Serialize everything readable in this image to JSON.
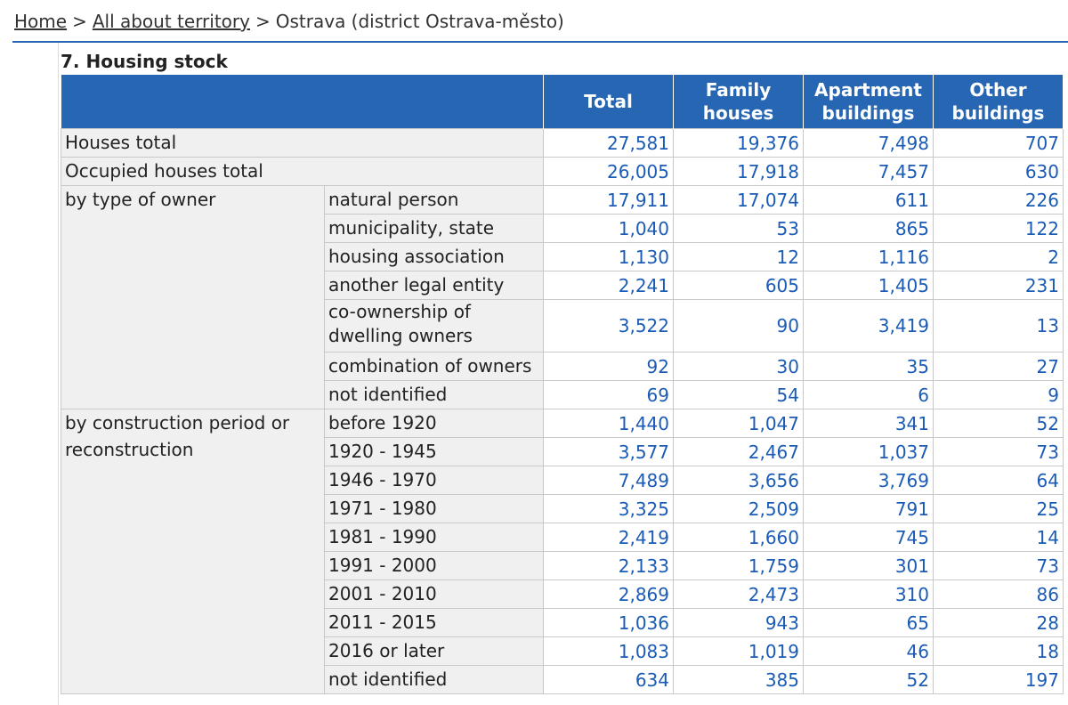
{
  "breadcrumb": {
    "home": "Home",
    "sep1": ">",
    "territory": "All about territory",
    "sep2": ">",
    "current": "Ostrava (district Ostrava-město)"
  },
  "section": {
    "title": "7. Housing stock"
  },
  "table": {
    "headers": [
      "Total",
      "Family houses",
      "Apartment buildings",
      "Other buildings"
    ],
    "rows_total": [
      {
        "label": "Houses total",
        "values": [
          "27,581",
          "19,376",
          "7,498",
          "707"
        ]
      },
      {
        "label": "Occupied houses total",
        "values": [
          "26,005",
          "17,918",
          "7,457",
          "630"
        ]
      }
    ],
    "owner_group": {
      "label": "by type of owner",
      "rows": [
        {
          "label": "natural person",
          "values": [
            "17,911",
            "17,074",
            "611",
            "226"
          ]
        },
        {
          "label": "municipality, state",
          "values": [
            "1,040",
            "53",
            "865",
            "122"
          ]
        },
        {
          "label": "housing association",
          "values": [
            "1,130",
            "12",
            "1,116",
            "2"
          ]
        },
        {
          "label": "another legal entity",
          "values": [
            "2,241",
            "605",
            "1,405",
            "231"
          ]
        },
        {
          "label": "co-ownership of dwelling owners",
          "values": [
            "3,522",
            "90",
            "3,419",
            "13"
          ]
        },
        {
          "label": "combination of owners",
          "values": [
            "92",
            "30",
            "35",
            "27"
          ]
        },
        {
          "label": "not identified",
          "values": [
            "69",
            "54",
            "6",
            "9"
          ]
        }
      ]
    },
    "period_group": {
      "label": "by construction period or reconstruction",
      "rows": [
        {
          "label": "before 1920",
          "values": [
            "1,440",
            "1,047",
            "341",
            "52"
          ]
        },
        {
          "label": "1920 - 1945",
          "values": [
            "3,577",
            "2,467",
            "1,037",
            "73"
          ]
        },
        {
          "label": "1946 - 1970",
          "values": [
            "7,489",
            "3,656",
            "3,769",
            "64"
          ]
        },
        {
          "label": "1971 - 1980",
          "values": [
            "3,325",
            "2,509",
            "791",
            "25"
          ]
        },
        {
          "label": "1981 - 1990",
          "values": [
            "2,419",
            "1,660",
            "745",
            "14"
          ]
        },
        {
          "label": "1991 - 2000",
          "values": [
            "2,133",
            "1,759",
            "301",
            "73"
          ]
        },
        {
          "label": "2001 - 2010",
          "values": [
            "2,869",
            "2,473",
            "310",
            "86"
          ]
        },
        {
          "label": "2011 - 2015",
          "values": [
            "1,036",
            "943",
            "65",
            "28"
          ]
        },
        {
          "label": "2016 or later",
          "values": [
            "1,083",
            "1,019",
            "46",
            "18"
          ]
        },
        {
          "label": "not identified",
          "values": [
            "634",
            "385",
            "52",
            "197"
          ]
        }
      ]
    }
  },
  "colors": {
    "header_bg": "#2766b3",
    "label_bg": "#f0f0f0",
    "value_text": "#1a5bb5"
  }
}
